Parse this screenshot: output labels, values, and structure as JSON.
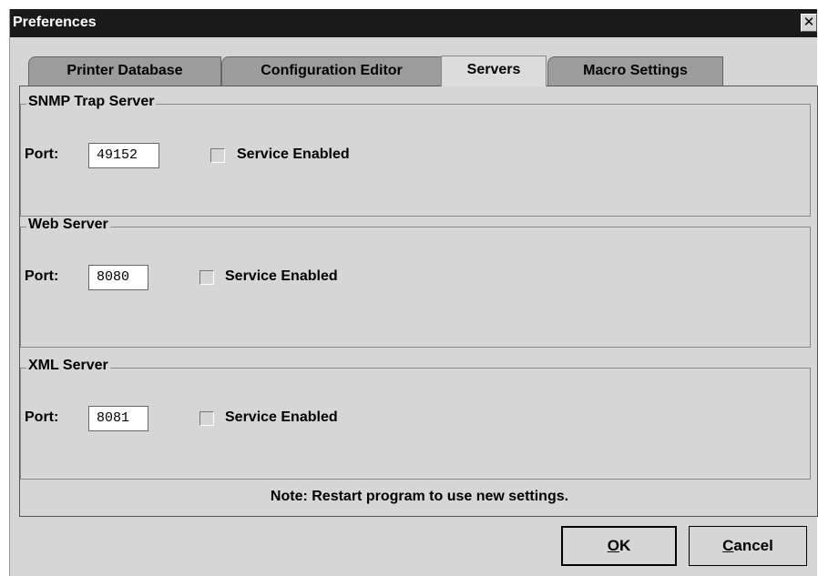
{
  "window": {
    "title": "Preferences",
    "close_glyph": "✕"
  },
  "tabs": [
    {
      "label": "Printer Database",
      "active": false
    },
    {
      "label": "Configuration Editor",
      "active": false
    },
    {
      "label": "Servers",
      "active": true
    },
    {
      "label": "Macro Settings",
      "active": false
    }
  ],
  "groups": [
    {
      "title": "SNMP Trap Server",
      "port_label": "Port:",
      "port_value": "49152",
      "checkbox_label": "Service Enabled",
      "checked": false
    },
    {
      "title": "Web Server",
      "port_label": "Port:",
      "port_value": "8080",
      "checkbox_label": "Service Enabled",
      "checked": false
    },
    {
      "title": "XML Server",
      "port_label": "Port:",
      "port_value": "8081",
      "checkbox_label": "Service Enabled",
      "checked": false
    }
  ],
  "note": "Note: Restart program to use new settings.",
  "buttons": {
    "ok_mnemonic": "O",
    "ok_rest": "K",
    "cancel_mnemonic": "C",
    "cancel_rest": "ancel"
  }
}
